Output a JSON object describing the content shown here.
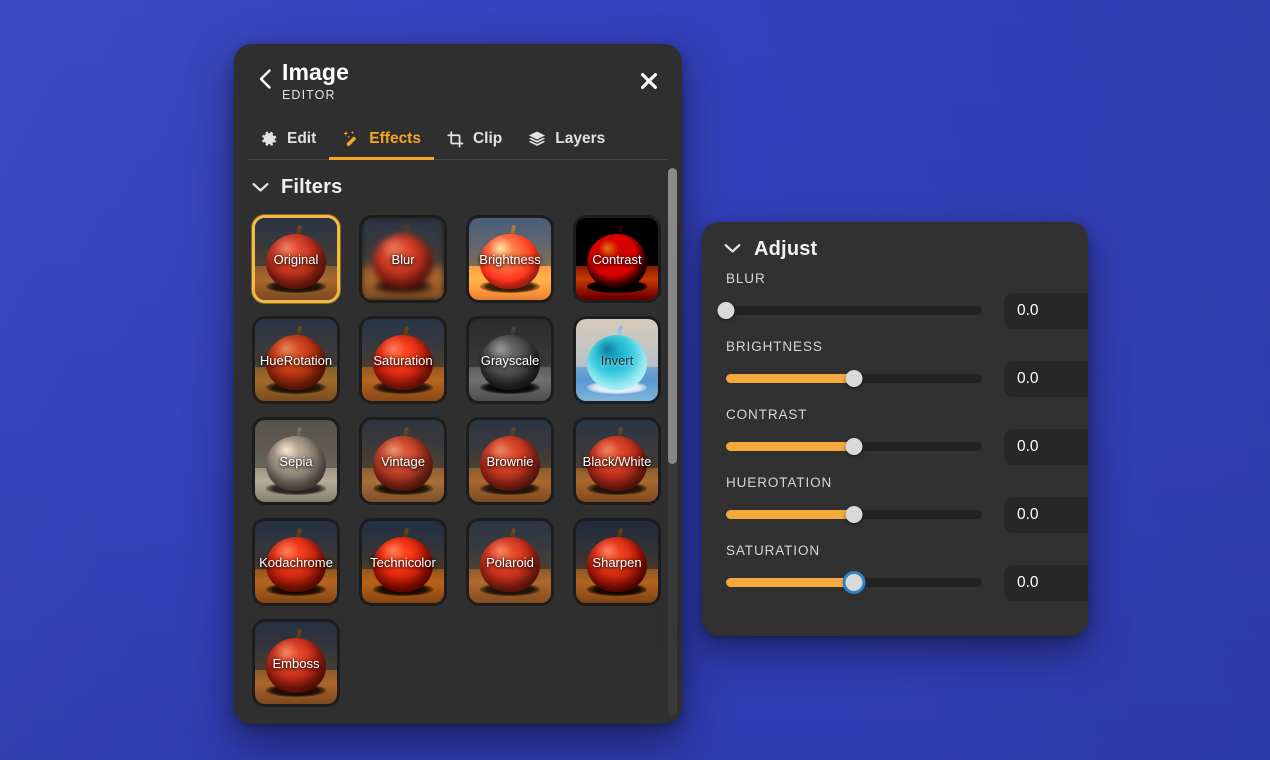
{
  "theme": {
    "background_color": "#3240b9",
    "panel_color": "#2f2f2f",
    "accent_color": "#f5a623",
    "slider_fill_color": "#f5a83c",
    "selected_border_color": "#f5b942",
    "focus_ring_color": "#2f81c4"
  },
  "editor": {
    "title": "Image",
    "subtitle": "EDITOR",
    "back_icon": "chevron-left-icon",
    "close_icon": "close-icon",
    "tabs": [
      {
        "label": "Edit",
        "icon": "gear-icon",
        "active": false
      },
      {
        "label": "Effects",
        "icon": "magic-wand-icon",
        "active": true
      },
      {
        "label": "Clip",
        "icon": "crop-icon",
        "active": false
      },
      {
        "label": "Layers",
        "icon": "layers-icon",
        "active": false
      }
    ],
    "filters_section": {
      "title": "Filters",
      "chevron_icon": "chevron-down-icon",
      "expanded": true,
      "selected": "Original",
      "items": [
        {
          "label": "Original",
          "fx": "fx-original",
          "selected": true,
          "dark_text": false
        },
        {
          "label": "Blur",
          "fx": "fx-blur",
          "selected": false,
          "dark_text": false
        },
        {
          "label": "Brightness",
          "fx": "fx-bright",
          "selected": false,
          "dark_text": false
        },
        {
          "label": "Contrast",
          "fx": "fx-contrast",
          "selected": false,
          "dark_text": false
        },
        {
          "label": "HueRotation",
          "fx": "fx-hue",
          "selected": false,
          "dark_text": false
        },
        {
          "label": "Saturation",
          "fx": "fx-saturate",
          "selected": false,
          "dark_text": false
        },
        {
          "label": "Grayscale",
          "fx": "fx-gray",
          "selected": false,
          "dark_text": false
        },
        {
          "label": "Invert",
          "fx": "fx-invert",
          "selected": false,
          "dark_text": true
        },
        {
          "label": "Sepia",
          "fx": "fx-sepia",
          "selected": false,
          "dark_text": false
        },
        {
          "label": "Vintage",
          "fx": "fx-vintage",
          "selected": false,
          "dark_text": false
        },
        {
          "label": "Brownie",
          "fx": "fx-brownie",
          "selected": false,
          "dark_text": false
        },
        {
          "label": "Black/White",
          "fx": "fx-bw",
          "selected": false,
          "dark_text": false
        },
        {
          "label": "Kodachrome",
          "fx": "fx-koda",
          "selected": false,
          "dark_text": false
        },
        {
          "label": "Technicolor",
          "fx": "fx-techni",
          "selected": false,
          "dark_text": false
        },
        {
          "label": "Polaroid",
          "fx": "fx-polaroid",
          "selected": false,
          "dark_text": false
        },
        {
          "label": "Sharpen",
          "fx": "fx-sharpen",
          "selected": false,
          "dark_text": false
        },
        {
          "label": "Emboss",
          "fx": "fx-emboss",
          "selected": false,
          "dark_text": false
        }
      ]
    },
    "scrollbar": {
      "thumb_position_percent": 0,
      "thumb_size_percent": 54
    }
  },
  "adjust": {
    "title": "Adjust",
    "chevron_icon": "chevron-down-icon",
    "expanded": true,
    "sliders": [
      {
        "label": "BLUR",
        "value": "0.0",
        "fill_percent": 0,
        "focused": false
      },
      {
        "label": "BRIGHTNESS",
        "value": "0.0",
        "fill_percent": 50,
        "focused": false
      },
      {
        "label": "CONTRAST",
        "value": "0.0",
        "fill_percent": 50,
        "focused": false
      },
      {
        "label": "HUEROTATION",
        "value": "0.0",
        "fill_percent": 50,
        "focused": false
      },
      {
        "label": "SATURATION",
        "value": "0.0",
        "fill_percent": 50,
        "focused": true
      }
    ]
  }
}
